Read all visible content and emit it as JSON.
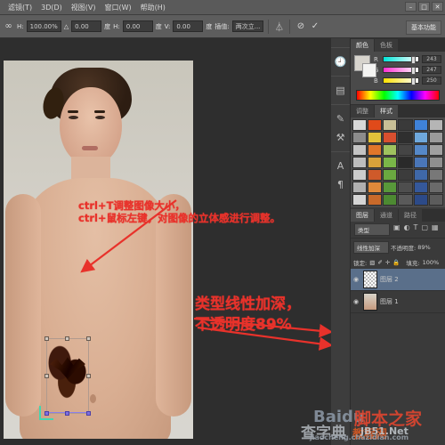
{
  "app": {
    "window_buttons": [
      "–",
      "□",
      "✕"
    ]
  },
  "menubar": {
    "items": [
      {
        "label": "滤镜(T)"
      },
      {
        "label": "3D(D)"
      },
      {
        "label": "视图(V)"
      },
      {
        "label": "窗口(W)"
      },
      {
        "label": "帮助(H)"
      }
    ]
  },
  "options_bar": {
    "link_icon": "link-icon",
    "fields": [
      {
        "label": "H:",
        "value": "100.00%"
      },
      {
        "label": "△",
        "value": "0.00"
      },
      {
        "label": "度",
        "value": ""
      },
      {
        "label": "H:",
        "value": "0.00"
      },
      {
        "label": "度",
        "value": ""
      },
      {
        "label": "V:",
        "value": "0.00"
      },
      {
        "label": "度",
        "value": ""
      }
    ],
    "interp_label": "插值:",
    "interp_value": "两次立...",
    "toggle_icon": "warp-toggle-icon",
    "cancel_icon": "cancel-icon",
    "commit_icon": "commit-check-icon",
    "workspace_button": "基本功能"
  },
  "canvas": {
    "annotation_1": "ctrl+T调整图像大小，\nctrl+鼠标左键，对图像的立体感进行调整。",
    "annotation_1_line1": "ctrl+T调整图像大小，",
    "annotation_1_line2": "ctrl+鼠标左键，对图像的立体感进行调整。",
    "annotation_2_line1": "类型线性加深，",
    "annotation_2_line2": "不透明度89%"
  },
  "dock_icons": [
    {
      "name": "history-icon",
      "glyph": "🕘"
    },
    {
      "name": "actions-icon",
      "glyph": "▤"
    },
    {
      "name": "brush-icon",
      "glyph": "✎"
    },
    {
      "name": "clone-source-icon",
      "glyph": "⚒"
    },
    {
      "name": "character-icon",
      "glyph": "A"
    },
    {
      "name": "paragraph-icon",
      "glyph": "¶"
    }
  ],
  "color_panel": {
    "tabs": [
      {
        "label": "颜色",
        "active": true
      },
      {
        "label": "色板",
        "active": false
      }
    ],
    "channels": [
      {
        "name": "R",
        "value": "243"
      },
      {
        "name": "G",
        "value": "247"
      },
      {
        "name": "B",
        "value": "250"
      }
    ]
  },
  "styles_panel": {
    "tabs": [
      {
        "label": "调整",
        "active": false
      },
      {
        "label": "样式",
        "active": true
      }
    ],
    "swatch_colors": [
      "#d8d8d8",
      "#e04a1a",
      "#c8bf96",
      "#3a3a3a",
      "#3f82d8",
      "#b5b5b5",
      "#8c8c8c",
      "#e2c23a",
      "#d84f2f",
      "#2f2f2f",
      "#6fa8dc",
      "#9a9a9a",
      "#c4c4c4",
      "#e0762a",
      "#9fc25e",
      "#454545",
      "#5588c8",
      "#a0a0a0",
      "#bdbdbd",
      "#d8a23a",
      "#7ab648",
      "#2a2a2a",
      "#4a76b8",
      "#8f8f8f",
      "#cccccc",
      "#cf5a2a",
      "#6aa840",
      "#3c3c3c",
      "#3f68a8",
      "#787878",
      "#b0b0b0",
      "#e08a3a",
      "#58983a",
      "#4e4e4e",
      "#35589a",
      "#6a6a6a",
      "#d4d4d4",
      "#c96a2a",
      "#4d8a32",
      "#5a5a5a",
      "#2c4a88",
      "#5c5c5c"
    ]
  },
  "layers_panel": {
    "tabs": [
      {
        "label": "图层",
        "active": true
      },
      {
        "label": "通道",
        "active": false
      },
      {
        "label": "路径",
        "active": false
      }
    ],
    "filter_label": "类型",
    "filter_icons": [
      "image-filter-icon",
      "adjust-filter-icon",
      "text-filter-icon",
      "shape-filter-icon",
      "smart-filter-icon"
    ],
    "blend_mode": "线性加深",
    "opacity_label": "不透明度:",
    "opacity_value": "89%",
    "lock_label": "锁定:",
    "lock_icons": [
      "lock-transparency-icon",
      "lock-brush-icon",
      "lock-move-icon",
      "lock-all-icon"
    ],
    "fill_label": "填充:",
    "fill_value": "100%",
    "layers": [
      {
        "name": "图层 2",
        "selected": true,
        "visible": true,
        "thumb": "checker"
      },
      {
        "name": "图层 1",
        "selected": false,
        "visible": true,
        "thumb": "photo"
      }
    ]
  },
  "watermarks": {
    "baidu": "Baidu",
    "jiaoben": "脚本之家",
    "chazidian": "查字典",
    "jiaocheng_url": "jiaocheng.chazidian.com",
    "jb_net": "JB51.Net",
    "jiaochengwang": "教程网"
  }
}
